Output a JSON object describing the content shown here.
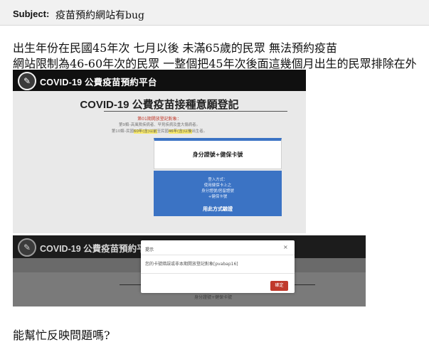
{
  "email": {
    "subject_label": "Subject:",
    "subject_value": "疫苗預約網站有bug",
    "body_lines": [
      "出生年份在民國45年次 七月以後 未滿65歲的民眾 無法預約疫苗",
      "網站限制為46-60年次的民眾 一整個把45年次後面這幾個月出生的民眾排除在外"
    ],
    "closing": "能幫忙反映問題嗎?"
  },
  "screenshot1": {
    "logo_icon": "syringe-icon",
    "site_title": "COVID-19 公費疫苗預約平台",
    "page_title": "COVID-19 公費疫苗接種意願登記",
    "notice_red": "第01期開放登記對象：",
    "notice_line1": "第9類–高風險疾病者、罕見疾病及重大傷病者。",
    "notice_line2_prefix": "第10類–民國",
    "notice_line2_hl1": "60年(含)以前",
    "notice_line2_mid": "至民國",
    "notice_line2_hl2": "46年(含)以後",
    "notice_line2_suffix": "出生者。",
    "card_white_label": "身分證號+健保卡號",
    "card_blue_lines": [
      "登入方式：",
      "使用健保卡上之",
      "身分證號/居留證號",
      "+健保卡號"
    ],
    "card_blue_verify": "用此方式驗證"
  },
  "screenshot2": {
    "logo_icon": "syringe-icon",
    "site_title": "COVID-19 公費疫苗預約平台",
    "background_label": "身分證號+健保卡號",
    "dialog": {
      "title": "提示",
      "close_glyph": "×",
      "message": "您的卡號錯誤或非本期開放登記對象[pvabap16]",
      "ok_label": "確定"
    }
  }
}
